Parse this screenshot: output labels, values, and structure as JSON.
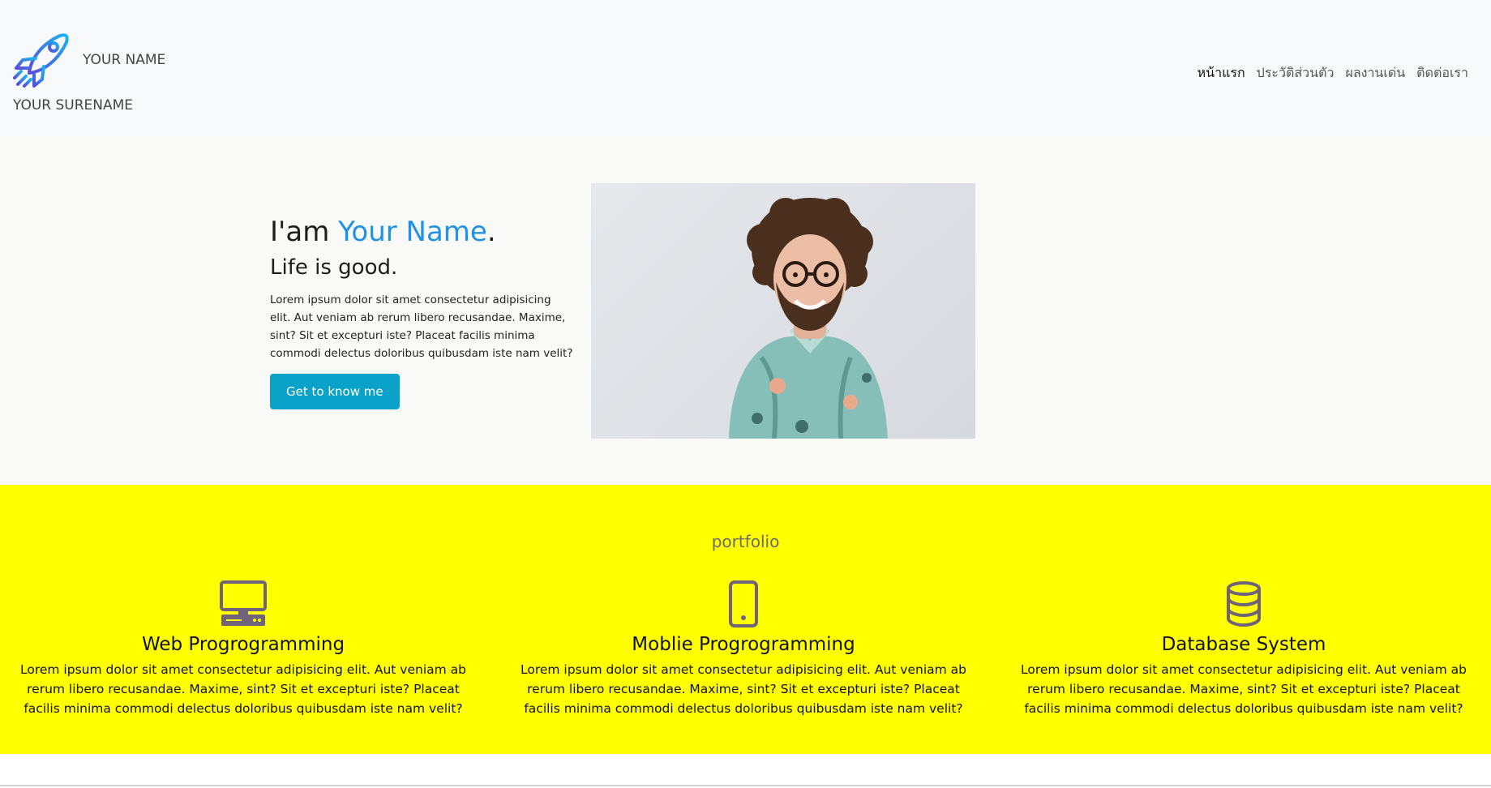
{
  "navbar": {
    "brand_name": "YOUR NAME",
    "brand_surname": "YOUR SURENAME",
    "logo_icon": "rocket-icon",
    "links": [
      "หน้าแรก",
      "ประวัติส่วนตัว",
      "ผลงานเด่น",
      "ติดต่อเรา"
    ],
    "active_link": "หน้าแรก"
  },
  "hero": {
    "greeting": "I'am ",
    "name": "Your Name",
    "period": ".",
    "tagline": "Life is good.",
    "body": "Lorem ipsum dolor sit amet consectetur adipisicing elit. Aut veniam ab rerum libero recusandae. Maxime, sint? Sit et excepturi iste? Placeat facilis minima commodi delectus doloribus quibusdam iste nam velit?",
    "button_label": "Get to know me",
    "photo_icon": "portrait-photo",
    "accent_color": "#1f92e8",
    "button_color": "#0aa2c9"
  },
  "portfolio": {
    "title": "portfolio",
    "background_color": "#ffff00",
    "items": [
      {
        "icon": "desktop-computer-icon",
        "title": "Web Progrogramming",
        "body": "Lorem ipsum dolor sit amet consectetur adipisicing elit. Aut veniam ab rerum libero recusandae. Maxime, sint? Sit et excepturi iste? Placeat facilis minima commodi delectus doloribus quibusdam iste nam velit?"
      },
      {
        "icon": "mobile-phone-icon",
        "title": "Moblie Progrogramming",
        "body": "Lorem ipsum dolor sit amet consectetur adipisicing elit. Aut veniam ab rerum libero recusandae. Maxime, sint? Sit et excepturi iste? Placeat facilis minima commodi delectus doloribus quibusdam iste nam velit?"
      },
      {
        "icon": "database-icon",
        "title": "Database System",
        "body": "Lorem ipsum dolor sit amet consectetur adipisicing elit. Aut veniam ab rerum libero recusandae. Maxime, sint? Sit et excepturi iste? Placeat facilis minima commodi delectus doloribus quibusdam iste nam velit?"
      }
    ]
  }
}
